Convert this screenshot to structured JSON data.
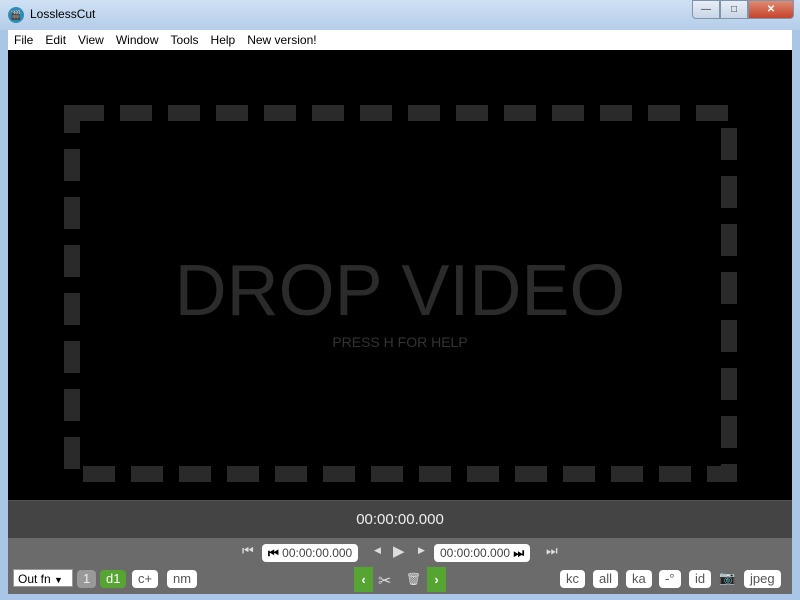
{
  "window": {
    "title": "LosslessCut",
    "minimize": "—",
    "maximize": "□",
    "close": "✕"
  },
  "menu": [
    "File",
    "Edit",
    "View",
    "Window",
    "Tools",
    "Help",
    "New version!"
  ],
  "video": {
    "drop_text": "DROP VIDEO",
    "help_text": "PRESS H FOR HELP"
  },
  "timeline": {
    "current_time": "00:00:00.000"
  },
  "controls": {
    "cut_start": "00:00:00.000",
    "cut_end": "00:00:00.000",
    "output_format": "Out fn",
    "segment_num": "1",
    "buttons_left": [
      "d1",
      "c+",
      "nm"
    ],
    "buttons_right": [
      "kc",
      "all",
      "ka",
      "-°",
      "id"
    ],
    "snapshot_format": "jpeg",
    "icons": {
      "jump_start": "⏮",
      "prev": "◀",
      "play": "▶",
      "next": "▶",
      "jump_end": "⏭",
      "cut": "✂",
      "trash": "🗑",
      "camera": "📷"
    }
  },
  "colors": {
    "accent": "#56a431",
    "bg": "#6b6b6b"
  }
}
